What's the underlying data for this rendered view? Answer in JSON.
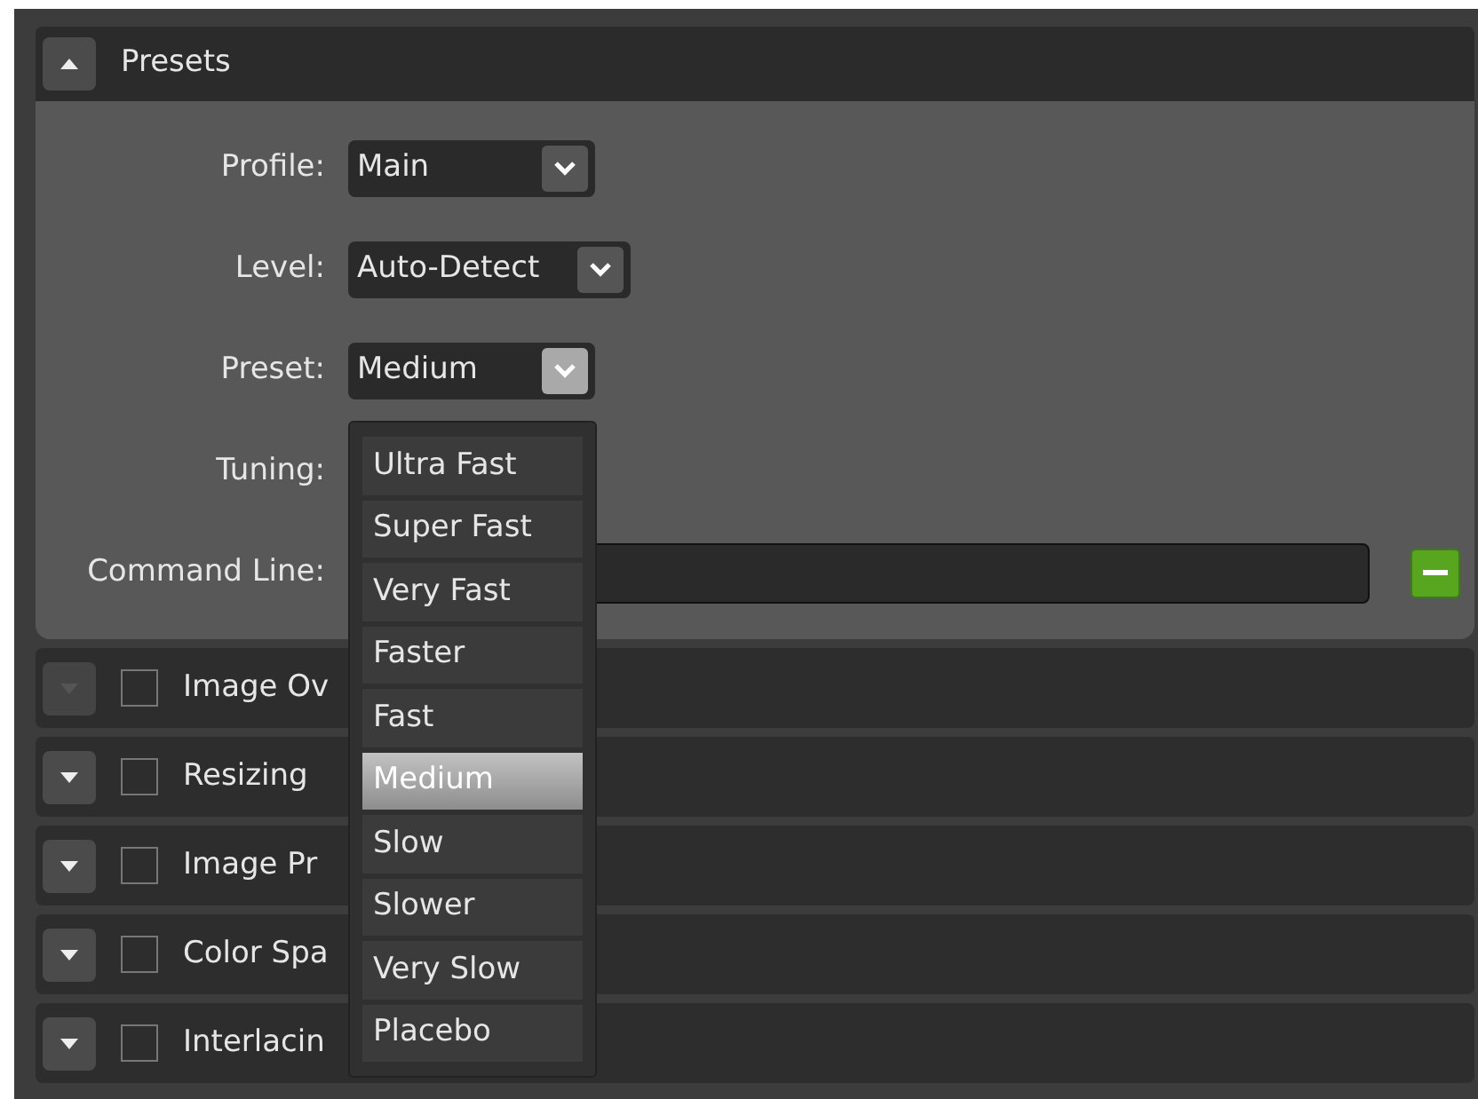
{
  "presets": {
    "title": "Presets",
    "expanded": true,
    "fields": [
      {
        "kind": "combo",
        "label": "Profile:",
        "value": "Main",
        "open": false
      },
      {
        "kind": "combo",
        "label": "Level:",
        "value": "Auto-Detect",
        "open": false
      },
      {
        "kind": "combo",
        "label": "Preset:",
        "value": "Medium",
        "open": true
      },
      {
        "kind": "hidden",
        "label": "Tuning:"
      },
      {
        "kind": "text",
        "label": "Command Line:"
      }
    ],
    "options": [
      {
        "label": "Ultra Fast",
        "selected": false
      },
      {
        "label": "Super Fast",
        "selected": false
      },
      {
        "label": "Very Fast",
        "selected": false
      },
      {
        "label": "Faster",
        "selected": false
      },
      {
        "label": "Fast",
        "selected": false
      },
      {
        "label": "Medium",
        "selected": true
      },
      {
        "label": "Slow",
        "selected": false
      },
      {
        "label": "Slower",
        "selected": false
      },
      {
        "label": "Very Slow",
        "selected": false
      },
      {
        "label": "Placebo",
        "selected": false
      }
    ]
  },
  "sections": [
    {
      "label": "Image Ov",
      "checked": false,
      "disabled": true
    },
    {
      "label": "Resizing",
      "checked": false,
      "disabled": false
    },
    {
      "label": "Image Pr",
      "checked": false,
      "disabled": false
    },
    {
      "label": "Color Spa",
      "checked": false,
      "disabled": false
    },
    {
      "label": "Interlacin",
      "checked": false,
      "disabled": false
    }
  ]
}
